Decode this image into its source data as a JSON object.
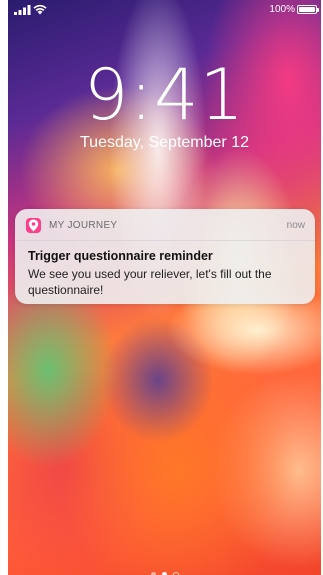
{
  "status_bar": {
    "signal_icon": "cellular-signal-icon",
    "wifi_icon": "wifi-icon",
    "battery_percent": "100%",
    "battery_icon": "battery-icon"
  },
  "lock_screen": {
    "time": "9:41",
    "date": "Tuesday, September 12"
  },
  "notification": {
    "app_icon": "location-pin-icon",
    "app_icon_color": "#ff3d8b",
    "app_name": "MY JOURNEY",
    "time": "now",
    "title": "Trigger questionnaire reminder",
    "body": "We see you used your reliever, let's fill out the questionnaire!"
  },
  "page_indicator": {
    "pages": 3,
    "active_page": 2
  }
}
